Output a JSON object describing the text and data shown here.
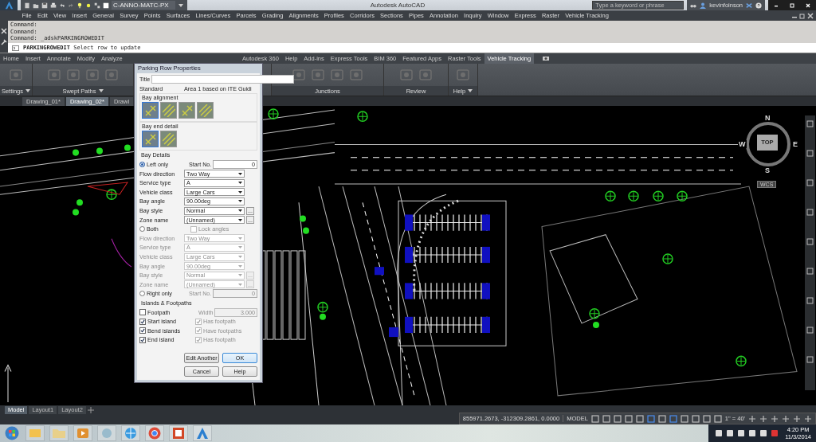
{
  "title_bar": {
    "workspace": "C-ANNO-MATC-PX",
    "title": "Autodesk AutoCAD",
    "search": {
      "placeholder": "Type a keyword or phrase"
    },
    "user": "kevinfoinson"
  },
  "menu_bar": [
    "File",
    "Edit",
    "View",
    "Insert",
    "General",
    "Survey",
    "Points",
    "Surfaces",
    "Lines/Curves",
    "Parcels",
    "Grading",
    "Alignments",
    "Profiles",
    "Corridors",
    "Sections",
    "Pipes",
    "Annotation",
    "Inquiry",
    "Window",
    "Express",
    "Raster",
    "Vehicle Tracking"
  ],
  "command_line": {
    "history": [
      "Command:",
      "Command:",
      "Command:  _adskPARKINGROWEDIT"
    ],
    "prompt_command": "PARKINGROWEDIT",
    "prompt_text": "Select row to update"
  },
  "ribbon": {
    "tabs_left": [
      {
        "label": "Home",
        "selected": false
      },
      {
        "label": "Insert",
        "selected": false
      },
      {
        "label": "Annotate",
        "selected": false
      },
      {
        "label": "Modify",
        "selected": false
      },
      {
        "label": "Analyze",
        "selected": false
      }
    ],
    "tabs_right": [
      {
        "label": "Autodesk 360",
        "selected": false
      },
      {
        "label": "Help",
        "selected": false
      },
      {
        "label": "Add-ins",
        "selected": false
      },
      {
        "label": "Express Tools",
        "selected": false
      },
      {
        "label": "BIM 360",
        "selected": false
      },
      {
        "label": "Featured Apps",
        "selected": false
      },
      {
        "label": "Raster Tools",
        "selected": false
      },
      {
        "label": "Vehicle Tracking",
        "selected": true
      }
    ],
    "panels": [
      {
        "label": "Settings",
        "dropdown": true
      },
      {
        "label": "Swept Paths",
        "dropdown": true
      },
      {
        "label": "Junctions",
        "dropdown": false
      },
      {
        "label": "Review",
        "dropdown": false
      },
      {
        "label": "Help",
        "dropdown": true
      }
    ]
  },
  "file_tabs": [
    {
      "label": "Drawing_01*",
      "selected": false
    },
    {
      "label": "Drawing_02*",
      "selected": true
    },
    {
      "label": "Drawi",
      "selected": false
    }
  ],
  "viewcube": {
    "north": "N",
    "south": "S",
    "east": "E",
    "west": "W",
    "face": "TOP",
    "ucs": "WCS"
  },
  "dialog": {
    "title": "Parking Row Properties",
    "rows": [
      {
        "kind": "input",
        "label": "Title"
      },
      {
        "kind": "static",
        "label": "Standard",
        "value": "Area 1 based on ITE Guidi"
      },
      {
        "kind": "tiles",
        "label": "Bay alignment",
        "tiles": [
          {
            "selected": true
          },
          {
            "selected": false
          },
          {
            "selected": false
          },
          {
            "selected": false
          }
        ]
      },
      {
        "kind": "tiles",
        "label": "Bay end detail",
        "tiles": [
          {
            "selected": true
          },
          {
            "selected": false
          }
        ]
      },
      {
        "kind": "heading",
        "label": "Bay Details"
      },
      {
        "kind": "radio",
        "label": "Left only",
        "selected": true,
        "start_label": "Start No.",
        "start_value": "0",
        "disabled": false
      },
      {
        "kind": "select",
        "label": "Flow direction",
        "value": "Two Way",
        "disabled": false
      },
      {
        "kind": "select",
        "label": "Service type",
        "value": "A",
        "disabled": false
      },
      {
        "kind": "select",
        "label": "Vehicle class",
        "value": "Large Cars",
        "disabled": false
      },
      {
        "kind": "select",
        "label": "Bay angle",
        "value": "90.00deg",
        "disabled": false
      },
      {
        "kind": "select",
        "label": "Bay style",
        "value": "Normal",
        "more": "...",
        "disabled": false
      },
      {
        "kind": "select",
        "label": "Zone name",
        "value": "(Unnamed)",
        "more": "...",
        "disabled": false
      },
      {
        "kind": "radio",
        "label": "Both",
        "selected": false,
        "lock": {
          "label": "Lock angles",
          "checked": false,
          "disabled": true
        }
      },
      {
        "kind": "select",
        "label": "Flow direction",
        "value": "Two Way",
        "disabled": true
      },
      {
        "kind": "select",
        "label": "Service type",
        "value": "A",
        "disabled": true
      },
      {
        "kind": "select",
        "label": "Vehicle class",
        "value": "Large Cars",
        "disabled": true
      },
      {
        "kind": "select",
        "label": "Bay angle",
        "value": "90.00deg",
        "disabled": true
      },
      {
        "kind": "select",
        "label": "Bay style",
        "value": "Normal",
        "more": "...",
        "disabled": true
      },
      {
        "kind": "select",
        "label": "Zone name",
        "value": "(Unnamed)",
        "more": "...",
        "disabled": true
      },
      {
        "kind": "radio",
        "label": "Right only",
        "selected": false,
        "start_label": "Start No.",
        "start_value": "0",
        "disabled": true
      },
      {
        "kind": "heading",
        "label": "Islands & Footpaths"
      },
      {
        "kind": "check",
        "label": "Footpath",
        "checked": false,
        "width_label": "Width",
        "width_value": "3.000"
      },
      {
        "kind": "check",
        "label": "Start island",
        "checked": true,
        "sub": {
          "label": "Has footpath",
          "checked": true,
          "disabled": true
        }
      },
      {
        "kind": "check",
        "label": "Bend islands",
        "checked": true,
        "sub": {
          "label": "Have footpaths",
          "checked": true,
          "disabled": true
        }
      },
      {
        "kind": "check",
        "label": "End island",
        "checked": true,
        "sub": {
          "label": "Has footpath",
          "checked": true,
          "disabled": true
        }
      }
    ],
    "buttons": [
      {
        "label": "Edit Another",
        "default": false
      },
      {
        "label": "OK",
        "default": true
      },
      {
        "label": "Cancel",
        "default": false
      },
      {
        "label": "Help",
        "default": false
      }
    ]
  },
  "layout_tabs": [
    {
      "label": "Model",
      "selected": true
    },
    {
      "label": "Layout1",
      "selected": false
    },
    {
      "label": "Layout2",
      "selected": false
    }
  ],
  "status_bar": {
    "coordinates": "855971.2673, -312309.2861, 0.0000",
    "space": "MODEL",
    "scale": "1\" = 40'"
  },
  "taskbar": {
    "time": "4:20 PM",
    "date": "11/3/2014"
  }
}
